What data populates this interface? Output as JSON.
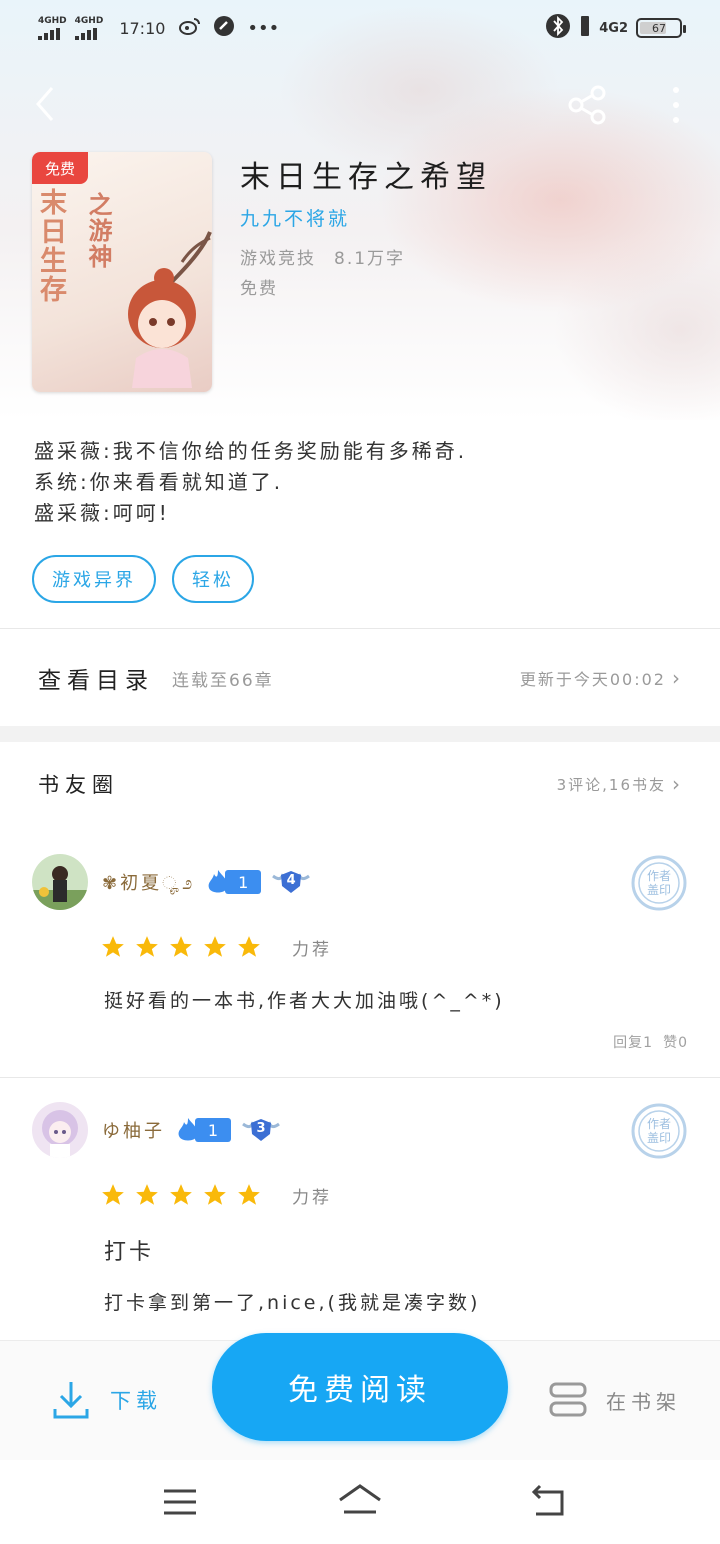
{
  "status_bar": {
    "signal1": "4GHD",
    "signal2": "4GHD",
    "time": "17:10",
    "network": "4G2",
    "battery": "67"
  },
  "book": {
    "badge": "免费",
    "title": "末日生存之希望",
    "author": "九九不将就",
    "category": "游戏竞技",
    "word_count": "8.1万字",
    "price": "免费",
    "cover_text": {
      "line1": "末日生存",
      "line2": "之游神",
      "badge": "免费"
    }
  },
  "synopsis": [
    "盛采薇:我不信你给的任务奖励能有多稀奇.",
    "系统:你来看看就知道了.",
    "盛采薇:呵呵!"
  ],
  "tags": [
    "游戏异界",
    "轻松"
  ],
  "catalog": {
    "title": "查看目录",
    "status": "连载至66章",
    "update": "更新于今天00:02"
  },
  "book_circle": {
    "title": "书友圈",
    "stats": "3评论,16书友"
  },
  "comments": [
    {
      "username": "✾初夏ೄ೨",
      "level": "1",
      "rank": "4",
      "rating_label": "力荐",
      "stars": 5,
      "text": "挺好看的一本书,作者大大加油哦(^_^*)",
      "replies": "回复1",
      "likes": "赞0",
      "stamp_text": "作者盖印"
    },
    {
      "username": "ゆ柚子",
      "level": "1",
      "rank": "3",
      "rating_label": "力荐",
      "stars": 5,
      "title": "打卡",
      "text": "打卡拿到第一了,nice,(我就是凑字数)",
      "stamp_text": "作者盖印"
    }
  ],
  "action_bar": {
    "download": "下载",
    "read": "免费阅读",
    "shelf": "在书架"
  },
  "colors": {
    "accent": "#2ba6e6",
    "read_button": "#17a7f4",
    "badge_red": "#e9463f",
    "star": "#f9b90a"
  }
}
